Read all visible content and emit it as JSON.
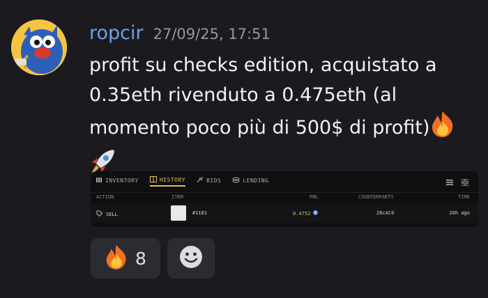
{
  "message": {
    "username": "ropcir",
    "timestamp": "27/09/25, 17:51",
    "text": "profit su checks edition, acquistato a 0.35eth rivenduto a 0.475eth (al momento poco più di 500$ di profit)",
    "emojis": [
      "fire-emoji",
      "rocket-emoji"
    ]
  },
  "embed": {
    "tabs": [
      {
        "label": "INVENTORY",
        "icon": "inventory-icon",
        "active": false
      },
      {
        "label": "HISTORY",
        "icon": "history-icon",
        "active": true
      },
      {
        "label": "BIDS",
        "icon": "bids-icon",
        "active": false
      },
      {
        "label": "LENDING",
        "icon": "lending-icon",
        "active": false
      }
    ],
    "columns": {
      "action": "ACTION",
      "item": "ITEM",
      "pnl": "PNL",
      "counterparty": "COUNTERPARTY",
      "time": "TIME"
    },
    "row": {
      "action": "SELL",
      "item": "#1181",
      "pnl": "0.4752",
      "counterparty": "26cAC0",
      "time": "20h ago"
    },
    "accent": "#e8c546",
    "pnl_color": "#b7d46a"
  },
  "reactions": [
    {
      "emoji": "fire-emoji",
      "count": "8"
    },
    {
      "emoji": "add-reaction-icon"
    }
  ]
}
